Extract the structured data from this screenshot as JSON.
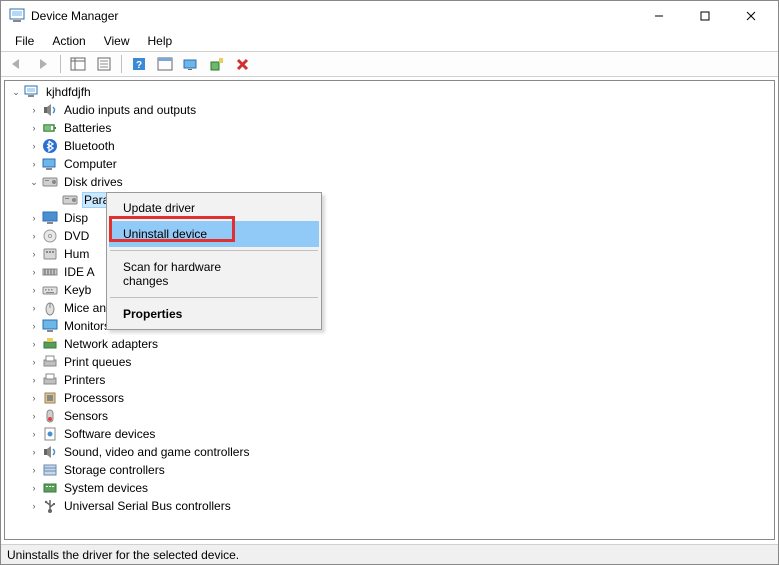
{
  "window": {
    "title": "Device Manager"
  },
  "menubar": {
    "items": [
      "File",
      "Action",
      "View",
      "Help"
    ]
  },
  "tree": {
    "root": "kjhdfdjfh",
    "disk_child": "Parallels Virtual NVMe Disk",
    "categories": [
      {
        "label": "Audio inputs and outputs",
        "icon": "speaker"
      },
      {
        "label": "Batteries",
        "icon": "battery"
      },
      {
        "label": "Bluetooth",
        "icon": "bluetooth"
      },
      {
        "label": "Computer",
        "icon": "computer"
      },
      {
        "label": "Disk drives",
        "icon": "disk",
        "expanded": true
      },
      {
        "label": "Display adapters",
        "icon": "display",
        "truncated": "Disp"
      },
      {
        "label": "DVD/CD-ROM drives",
        "icon": "dvd",
        "truncated": "DVD"
      },
      {
        "label": "Human Interface Devices",
        "icon": "hid",
        "truncated": "Hum"
      },
      {
        "label": "IDE ATA/ATAPI controllers",
        "icon": "ide",
        "truncated": "IDE A"
      },
      {
        "label": "Keyboards",
        "icon": "keyboard",
        "truncated": "Keyb"
      },
      {
        "label": "Mice and other pointing devices",
        "icon": "mouse"
      },
      {
        "label": "Monitors",
        "icon": "monitor"
      },
      {
        "label": "Network adapters",
        "icon": "network"
      },
      {
        "label": "Print queues",
        "icon": "printqueue"
      },
      {
        "label": "Printers",
        "icon": "printer"
      },
      {
        "label": "Processors",
        "icon": "cpu"
      },
      {
        "label": "Sensors",
        "icon": "sensor"
      },
      {
        "label": "Software devices",
        "icon": "software"
      },
      {
        "label": "Sound, video and game controllers",
        "icon": "sound"
      },
      {
        "label": "Storage controllers",
        "icon": "storage"
      },
      {
        "label": "System devices",
        "icon": "system"
      },
      {
        "label": "Universal Serial Bus controllers",
        "icon": "usb"
      }
    ]
  },
  "context_menu": {
    "items": [
      {
        "label": "Update driver"
      },
      {
        "label": "Uninstall device",
        "highlighted": true
      },
      {
        "sep": true
      },
      {
        "label": "Scan for hardware changes"
      },
      {
        "sep": true
      },
      {
        "label": "Properties",
        "bold": true
      }
    ]
  },
  "statusbar": {
    "text": "Uninstalls the driver for the selected device."
  }
}
